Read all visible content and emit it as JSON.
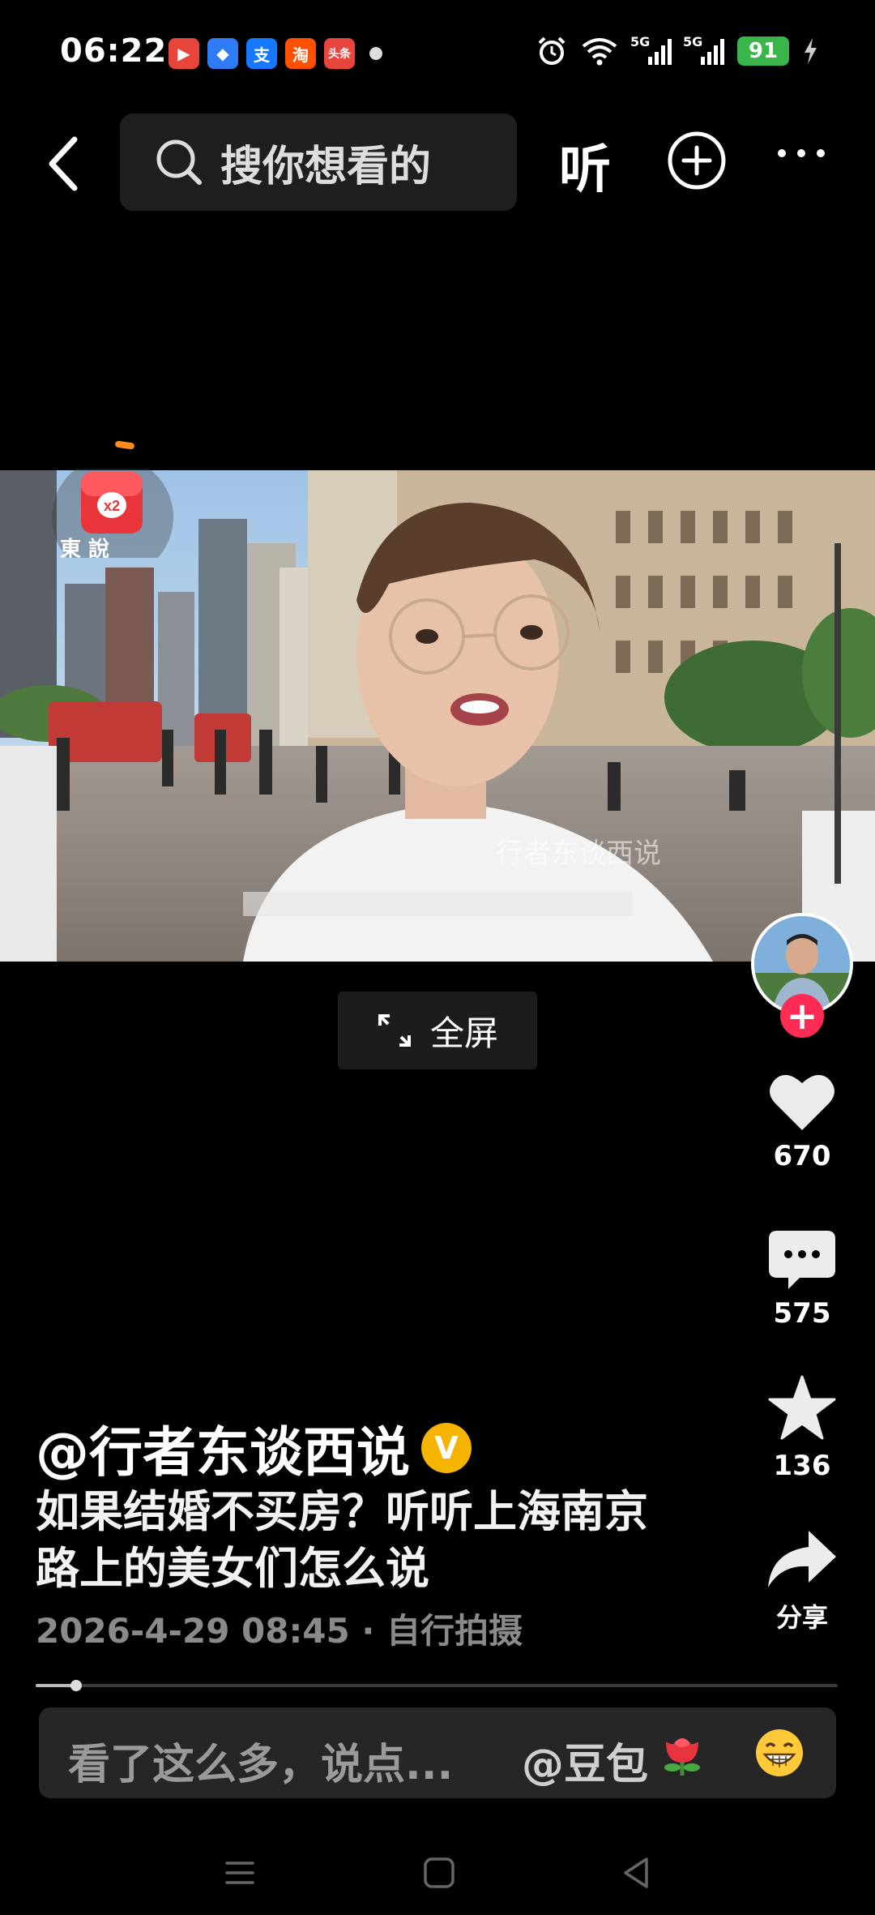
{
  "status_bar": {
    "time": "06:22",
    "app_icons": [
      {
        "name": "video-app-icon",
        "glyph": "▶",
        "color": "#e8453c"
      },
      {
        "name": "browser-app-icon",
        "glyph": "◆",
        "color": "#2f7cf6"
      },
      {
        "name": "alipay-app-icon",
        "glyph": "支",
        "color": "#1677ff"
      },
      {
        "name": "taobao-app-icon",
        "glyph": "淘",
        "color": "#ff5000"
      },
      {
        "name": "toutiao-app-icon",
        "glyph": "头条",
        "color": "#e8453c"
      }
    ],
    "signal_label_1": "5G",
    "signal_label_2": "5G",
    "battery": "91"
  },
  "top_nav": {
    "search_placeholder": "搜你想看的",
    "listen_label": "听"
  },
  "video": {
    "watermark": "行者东谈西说",
    "redpacket_multiplier": "x2",
    "logo_chars": "東 說"
  },
  "fullscreen_label": "全屏",
  "actions": {
    "like_count": "670",
    "comment_count": "575",
    "favorite_count": "136",
    "share_label": "分享"
  },
  "post": {
    "author": "@行者东谈西说",
    "verified_badge": "V",
    "description": "如果结婚不买房？听听上海南京路上的美女们怎么说",
    "meta": "2026-4-29 08:45 · 自行拍摄"
  },
  "progress": {
    "fraction": 0.05
  },
  "comment_bar": {
    "placeholder": "看了这么多，说点...",
    "mention": "@豆包"
  },
  "colors": {
    "accent_red": "#fe2c55",
    "verified_gold": "#f5b400",
    "battery_green": "#39b54a"
  }
}
